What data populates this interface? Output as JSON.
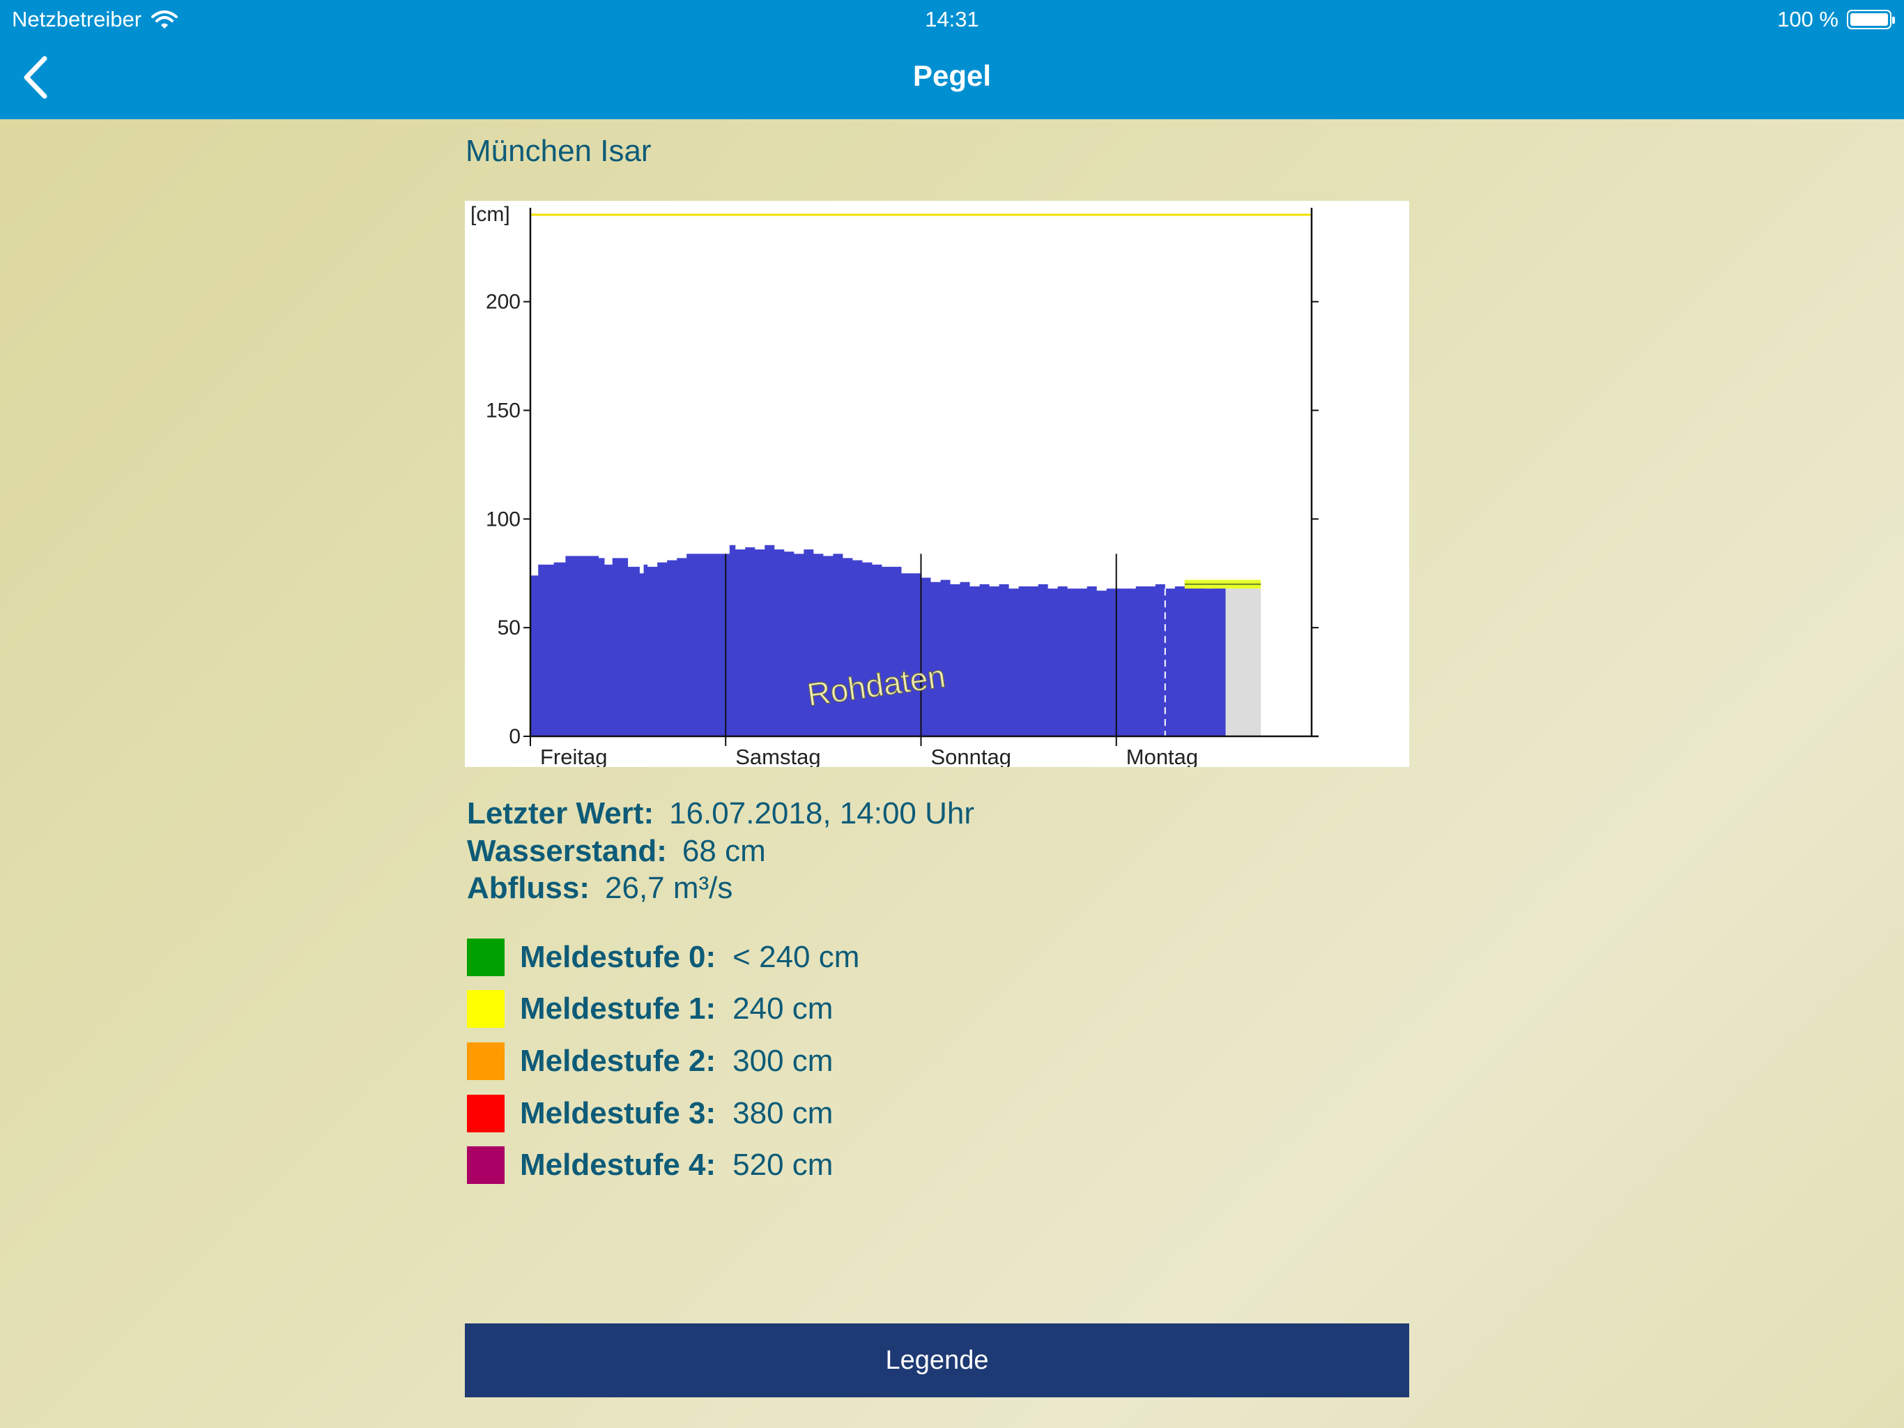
{
  "status_bar": {
    "carrier": "Netzbetreiber",
    "time": "14:31",
    "battery": "100 %"
  },
  "nav": {
    "title": "Pegel"
  },
  "station_name": "München Isar",
  "chart_data": {
    "type": "area",
    "unit_label": "[cm]",
    "watermark": "Rohdaten",
    "y_ticks": [
      0,
      50,
      100,
      150,
      200
    ],
    "ylim": [
      0,
      240
    ],
    "xlim": [
      0,
      4
    ],
    "days": [
      "Freitag",
      "Samstag",
      "Sonntag",
      "Montag"
    ],
    "threshold_line": 240,
    "now_marker_x": 3.25,
    "data_end_x": 3.56,
    "forecast_end_x": 3.74,
    "forecast_band": [
      68,
      72
    ],
    "series": [
      {
        "x": [
          0.0,
          0.04,
          0.12,
          0.18,
          0.35,
          0.38,
          0.42,
          0.5,
          0.56,
          0.58,
          0.6,
          0.65,
          0.7,
          0.75,
          0.8,
          0.85,
          0.9,
          0.95,
          1.0,
          1.02,
          1.05,
          1.1,
          1.15,
          1.2,
          1.25,
          1.3,
          1.35,
          1.4,
          1.45,
          1.5,
          1.55,
          1.6,
          1.65,
          1.7,
          1.75,
          1.8,
          1.9,
          2.0,
          2.05,
          2.1,
          2.15,
          2.2,
          2.25,
          2.3,
          2.35,
          2.4,
          2.45,
          2.5,
          2.55,
          2.6,
          2.65,
          2.7,
          2.75,
          2.8,
          2.85,
          2.9,
          2.95,
          3.0,
          3.05,
          3.1,
          3.15,
          3.2,
          3.25,
          3.3,
          3.35,
          3.4,
          3.45,
          3.5,
          3.56
        ],
        "values": [
          74,
          79,
          80,
          83,
          82,
          79,
          82,
          78,
          75,
          79,
          78,
          80,
          81,
          82,
          84,
          84,
          84,
          84,
          84,
          88,
          86,
          87,
          86,
          88,
          86,
          85,
          84,
          86,
          84,
          83,
          84,
          82,
          81,
          80,
          79,
          78,
          75,
          73,
          71,
          72,
          70,
          71,
          69,
          70,
          69,
          70,
          68,
          69,
          69,
          70,
          68,
          69,
          68,
          68,
          69,
          67,
          68,
          68,
          68,
          69,
          69,
          70,
          68,
          69,
          70,
          69,
          68,
          69,
          68
        ]
      }
    ]
  },
  "last_value": {
    "label": "Letzter Wert:",
    "value": "16.07.2018, 14:00 Uhr"
  },
  "water_level": {
    "label": "Wasserstand:",
    "value": "68 cm"
  },
  "discharge": {
    "label": "Abfluss:",
    "value": "26,7 m³/s"
  },
  "levels": [
    {
      "label": "Meldestufe 0:",
      "value": "< 240 cm",
      "color": "#00a000"
    },
    {
      "label": "Meldestufe 1:",
      "value": "240 cm",
      "color": "#ffff00"
    },
    {
      "label": "Meldestufe 2:",
      "value": "300 cm",
      "color": "#ff9a00"
    },
    {
      "label": "Meldestufe 3:",
      "value": "380 cm",
      "color": "#ff0000"
    },
    {
      "label": "Meldestufe 4:",
      "value": "520 cm",
      "color": "#aa0066"
    }
  ],
  "legend_button": {
    "label": "Legende"
  }
}
